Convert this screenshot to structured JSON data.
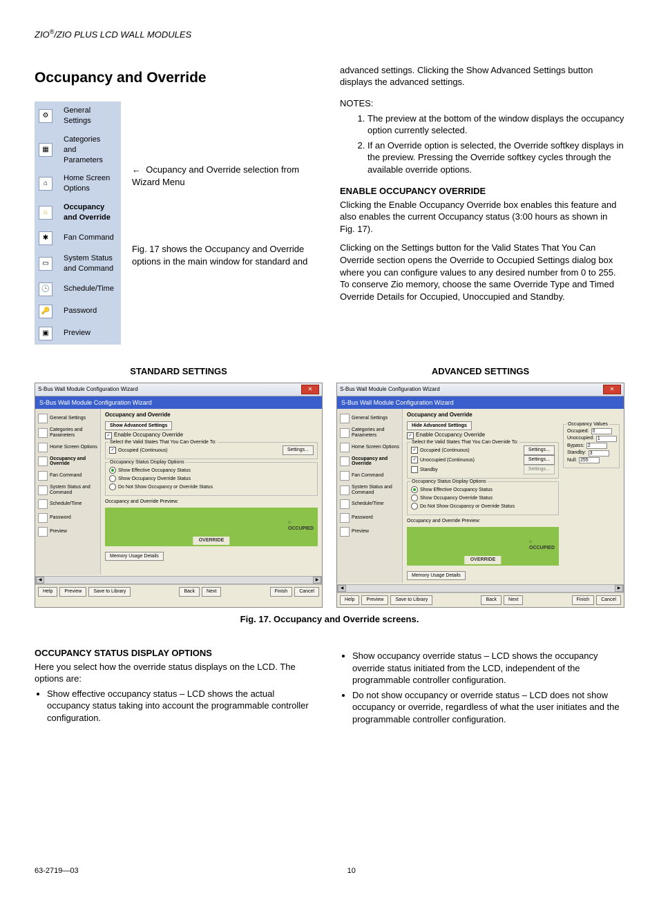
{
  "header": "ZIO®/ZIO PLUS LCD WALL MODULES",
  "h1": "Occupancy and Override",
  "wizard_menu": [
    "General Settings",
    "Categories and Parameters",
    "Home Screen Options",
    "Occupancy and Override",
    "Fan Command",
    "System Status and Command",
    "Schedule/Time",
    "Password",
    "Preview"
  ],
  "arrow": "←",
  "arrow_note": "Ocupancy and Override selection from Wizard Menu",
  "left_para": "Fig. 17 shows the Occupancy and Override options in the main window for standard and",
  "right_top": "advanced settings. Clicking the Show Advanced Settings button displays the advanced settings.",
  "notes_h": "NOTES:",
  "notes": [
    "The preview at the bottom of the window displays the occupancy option currently selected.",
    "If an Override option is selected, the Override softkey displays in the preview. Pressing the Override softkey cycles through the available override options."
  ],
  "enable_h": "ENABLE OCCUPANCY OVERRIDE",
  "enable_p": "Clicking the Enable Occupancy Override box enables this feature and also enables the current Occupancy status (3:00 hours as shown in Fig. 17).",
  "enable_p2": "Clicking on the Settings button for the Valid States That You Can Override section opens the Override to Occupied Settings dialog box where you can configure values to any desired number from 0 to 255. To conserve Zio memory, choose the same Override Type and Timed Override Details for Occupied, Unoccupied and Standby.",
  "std_label": "STANDARD SETTINGS",
  "adv_label": "ADVANCED SETTINGS",
  "win": {
    "title": "S-Bus Wall Module Configuration Wizard",
    "blue": "S-Bus Wall Module Configuration Wizard",
    "nav": [
      "General Settings",
      "Categories and Parameters",
      "Home Screen Options",
      "Occupancy and Override",
      "Fan Command",
      "System Status and Command",
      "Schedule/Time",
      "Password",
      "Preview"
    ],
    "panel_title": "Occupancy and Override",
    "show_adv": "Show Advanced Settings",
    "hide_adv": "Hide Advanced Settings",
    "enable_chk": "Enable Occupancy Override",
    "valid_legend": "Select the Valid States That You Can Override To:",
    "occ_cont": "Occupied (Continuous)",
    "unocc_cont": "Unoccupied (Continuous)",
    "standby": "Standby",
    "settings_btn": "Settings...",
    "disp_legend": "Occupancy Status Display Options",
    "r1": "Show Effective Occupancy Status",
    "r2": "Show Occupancy Override Status",
    "r3": "Do Not Show Occupancy or Override Status",
    "prev_legend": "Occupancy and Override Preview:",
    "prev_occ": "OCCUPIED",
    "prev_btn": "OVERRIDE",
    "mem": "Memory Usage Details",
    "vals_legend": "Occupancy Values",
    "vals": {
      "Occupied:": "0",
      "Unoccupied:": "1",
      "Bypass:": "2",
      "Standby:": "3",
      "Null:": "255"
    },
    "footer": {
      "help": "Help",
      "preview": "Preview",
      "save": "Save to Library",
      "back": "Back",
      "next": "Next",
      "finish": "Finish",
      "cancel": "Cancel"
    }
  },
  "fig_caption": "Fig. 17. Occupancy and Override screens.",
  "osdo_h": "OCCUPANCY STATUS DISPLAY OPTIONS",
  "osdo_p": "Here you select how the override status displays on the LCD. The options are:",
  "osdo_b1": "Show effective occupancy status – LCD shows the actual occupancy status taking into account the programmable controller configuration.",
  "osdo_b2": "Show occupancy override status – LCD shows the occupancy override status initiated from the LCD, independent of the programmable controller configuration.",
  "osdo_b3": "Do not show occupancy or override status – LCD does not show occupancy or override, regardless of what the user initiates and the programmable controller configuration.",
  "footer_left": "63-2719—03",
  "footer_page": "10"
}
